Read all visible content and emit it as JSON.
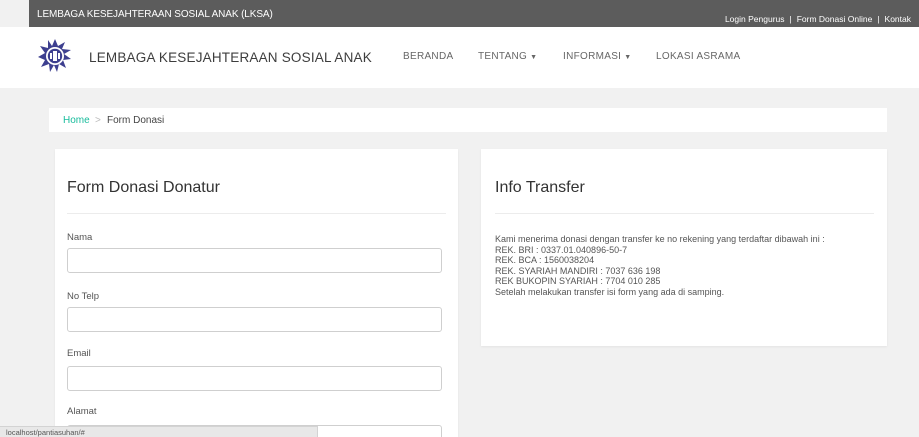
{
  "topbar": {
    "brand": "LEMBAGA KESEJAHTERAAN SOSIAL ANAK (LKSA)",
    "links": [
      "Login Pengurus",
      "Form Donasi Online",
      "Kontak"
    ],
    "separator": "|"
  },
  "navbar": {
    "site_title": "LEMBAGA KESEJAHTERAAN SOSIAL ANAK",
    "items": [
      {
        "label": "BERANDA"
      },
      {
        "label": "TENTANG"
      },
      {
        "label": "INFORMASI"
      },
      {
        "label": "LOKASI ASRAMA"
      }
    ],
    "caret": "▼"
  },
  "breadcrumb": {
    "home": "Home",
    "separator": ">",
    "current": "Form Donasi"
  },
  "form": {
    "title": "Form Donasi Donatur",
    "fields": [
      {
        "label": "Nama",
        "value": ""
      },
      {
        "label": "No Telp",
        "value": ""
      },
      {
        "label": "Email",
        "value": ""
      },
      {
        "label": "Alamat",
        "value": ""
      }
    ]
  },
  "info": {
    "title": "Info Transfer",
    "lines": [
      "Kami menerima donasi dengan transfer ke no rekening yang terdaftar dibawah ini :",
      "REK. BRI : 0337.01.040896-50-7",
      "REK. BCA : 1560038204",
      "REK. SYARIAH MANDIRI : 7037 636 198",
      "REK BUKOPIN SYARIAH : 7704 010 285",
      "Setelah melakukan transfer isi form yang ada di samping."
    ]
  },
  "statusbar": {
    "url": "localhost/pantiasuhan/#"
  },
  "colors": {
    "topbar_bg": "#5c5c5c",
    "accent": "#18bc9c",
    "logo_primary": "#3d3f8f"
  }
}
